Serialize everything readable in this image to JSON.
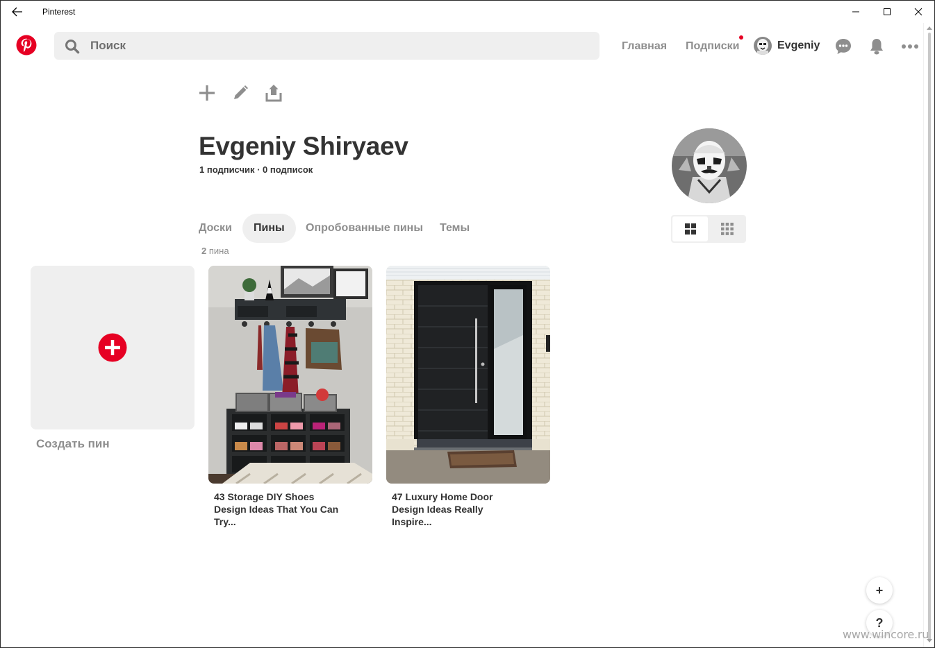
{
  "window": {
    "title": "Pinterest"
  },
  "header": {
    "search_placeholder": "Поиск",
    "nav_home": "Главная",
    "nav_subscriptions": "Подписки",
    "user_name": "Evgeniy",
    "icons": [
      "pinterest-logo",
      "search-icon",
      "messages-icon",
      "bell-icon",
      "more-icon"
    ],
    "notification_color": "#e60023"
  },
  "profile": {
    "name": "Evgeniy Shiryaev",
    "stats": "1 подписчик · 0 подписок"
  },
  "tabs": [
    {
      "label": "Доски",
      "active": false
    },
    {
      "label": "Пины",
      "active": true
    },
    {
      "label": "Опробованные пины",
      "active": false
    },
    {
      "label": "Темы",
      "active": false
    }
  ],
  "pin_count": {
    "number": "2",
    "unit": "пина"
  },
  "create_pin": {
    "label": "Создать пин"
  },
  "pins": [
    {
      "title": "43 Storage DIY Shoes Design Ideas That You Can Try..."
    },
    {
      "title": "47 Luxury Home Door Design Ideas Really Inspire..."
    }
  ],
  "floating": {
    "add": "+",
    "help": "?"
  },
  "watermark": "www.wincore.ru",
  "colors": {
    "brand": "#e60023",
    "surface": "#efefef",
    "text": "#333333",
    "muted": "#8e8e8e"
  }
}
